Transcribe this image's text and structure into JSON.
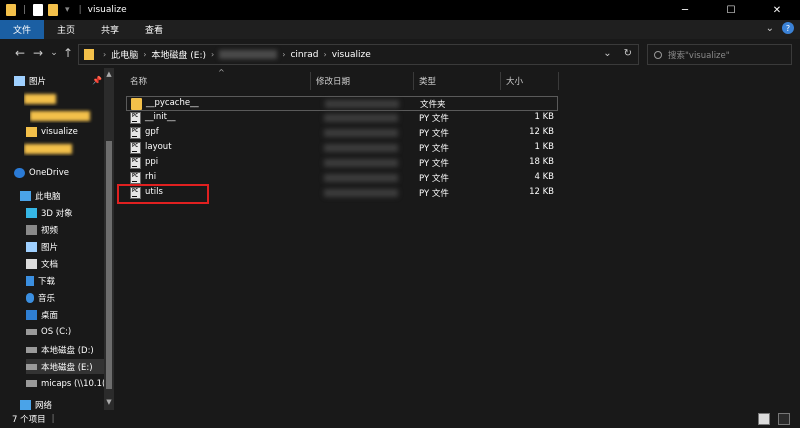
{
  "window": {
    "title": "visualize",
    "minimize": "─",
    "maximize": "☐",
    "close": "✕"
  },
  "ribbon": {
    "tabs": [
      "文件",
      "主页",
      "共享",
      "查看"
    ],
    "expand": "⌄",
    "help": "?"
  },
  "nav": {
    "back": "←",
    "forward": "→",
    "recent": "⌄",
    "up": "↑",
    "breadcrumb": [
      "此电脑",
      "本地磁盘 (E:)",
      "cinrad",
      "visualize"
    ],
    "dropdown": "⌄",
    "refresh": "↻",
    "search_placeholder": "搜索\"visualize\""
  },
  "sidebar": {
    "items": [
      {
        "label": "图片",
        "icon": "pictures-icon"
      },
      {
        "label": "",
        "icon": "folder-icon"
      },
      {
        "label": "",
        "icon": "folder-icon"
      },
      {
        "label": "visualize",
        "icon": "folder-icon"
      },
      {
        "label": "",
        "icon": "folder-icon"
      },
      {
        "label": "OneDrive",
        "icon": "onedrive-icon"
      },
      {
        "label": "此电脑",
        "icon": "computer-icon"
      },
      {
        "label": "3D 对象",
        "icon": "3d-objects-icon"
      },
      {
        "label": "视频",
        "icon": "videos-icon"
      },
      {
        "label": "图片",
        "icon": "pictures-icon"
      },
      {
        "label": "文档",
        "icon": "documents-icon"
      },
      {
        "label": "下载",
        "icon": "downloads-icon"
      },
      {
        "label": "音乐",
        "icon": "music-icon"
      },
      {
        "label": "桌面",
        "icon": "desktop-icon"
      },
      {
        "label": "OS (C:)",
        "icon": "drive-c-icon"
      },
      {
        "label": "本地磁盘 (D:)",
        "icon": "drive-icon"
      },
      {
        "label": "本地磁盘 (E:)",
        "icon": "drive-icon"
      },
      {
        "label": "micaps (\\\\10.1(",
        "icon": "network-drive-icon"
      },
      {
        "label": "网络",
        "icon": "network-icon"
      }
    ],
    "scroll_up": "▲",
    "scroll_down": "▼"
  },
  "columns": {
    "name": "名称",
    "modified": "修改日期",
    "type": "类型",
    "size": "大小",
    "sort_caret": "^"
  },
  "files": [
    {
      "name": "__pycache__",
      "type": "文件夹",
      "size": "",
      "icon": "folder-icon"
    },
    {
      "name": "__init__",
      "type": "PY 文件",
      "size": "1 KB",
      "icon": "python-file-icon"
    },
    {
      "name": "gpf",
      "type": "PY 文件",
      "size": "12 KB",
      "icon": "python-file-icon"
    },
    {
      "name": "layout",
      "type": "PY 文件",
      "size": "1 KB",
      "icon": "python-file-icon"
    },
    {
      "name": "ppi",
      "type": "PY 文件",
      "size": "18 KB",
      "icon": "python-file-icon"
    },
    {
      "name": "rhi",
      "type": "PY 文件",
      "size": "4 KB",
      "icon": "python-file-icon"
    },
    {
      "name": "utils",
      "type": "PY 文件",
      "size": "12 KB",
      "icon": "python-file-icon"
    }
  ],
  "status": {
    "count": "7 个项目"
  },
  "colors": {
    "background": "#191919",
    "accent": "#1b5fa3",
    "highlight": "#e02020",
    "folder": "#f3c04a"
  }
}
